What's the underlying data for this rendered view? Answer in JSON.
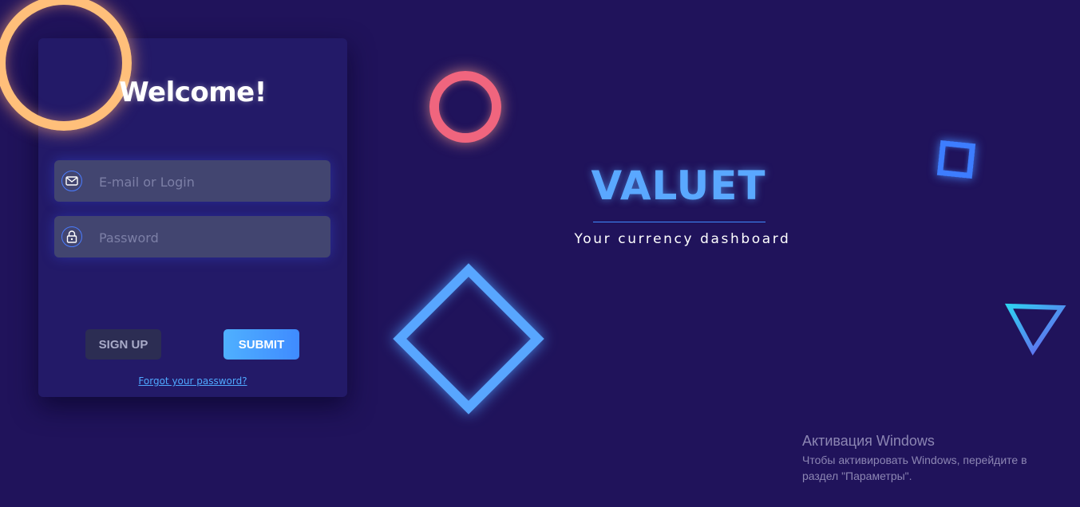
{
  "login": {
    "title": "Welcome!",
    "email_placeholder": "E-mail or Login",
    "email_icon": "mail-icon",
    "password_placeholder": "Password",
    "password_icon": "lock-icon",
    "signup_label": "SIGN UP",
    "submit_label": "SUBMIT",
    "forgot_link": "Forgot your password?"
  },
  "brand": {
    "name": "VALUET",
    "tagline": "Your currency dashboard"
  },
  "windows_activation": {
    "title": "Активация Windows",
    "line1": "Чтобы активировать Windows, перейдите в",
    "line2": "раздел \"Параметры\"."
  },
  "colors": {
    "background": "#20135b",
    "card": "#231a68",
    "accent_blue": "#5aa8ff",
    "submit": "#4fb0ff",
    "orange_ring": "#ffbf7a",
    "pink_ring": "#f0657e"
  }
}
